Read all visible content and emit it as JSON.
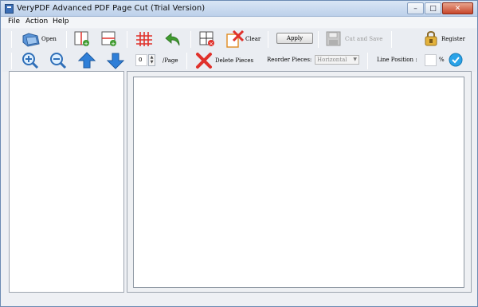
{
  "window": {
    "title": "VeryPDF Advanced PDF Page Cut (Trial Version)",
    "controls": {
      "minimize": "–",
      "maximize": "□",
      "close": "✕"
    }
  },
  "menu": {
    "items": [
      "File",
      "Action",
      "Help"
    ]
  },
  "toolbar_top": {
    "open_label": "Open",
    "clear_label": "Clear",
    "apply_label": "Apply",
    "cut_save_label": "Cut and Save",
    "register_label": "Register"
  },
  "toolbar_bottom": {
    "page_value": "0",
    "page_suffix": "/Page",
    "delete_pieces_label": "Delete Pieces",
    "reorder_label": "Reorder Pieces:",
    "reorder_selected": "Horizontal",
    "line_position_label": "Line Position :",
    "line_position_value": "",
    "percent_label": "%"
  },
  "colors": {
    "accent_blue": "#2f7fd8",
    "cut_red": "#e0312b",
    "undo_green": "#3f9b2f"
  }
}
